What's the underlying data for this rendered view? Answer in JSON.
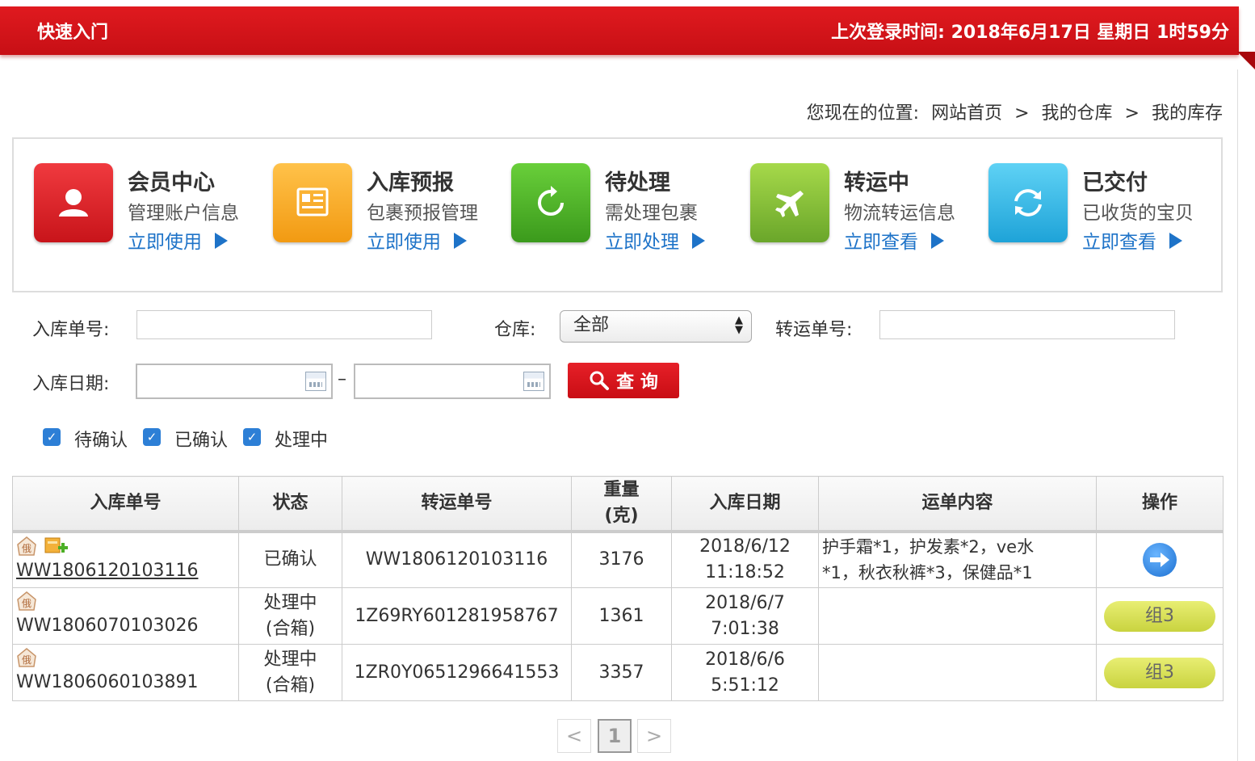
{
  "header": {
    "title": "快速入门",
    "last_login": "上次登录时间: 2018年6月17日 星期日 1时59分"
  },
  "breadcrumb": {
    "prefix": "您现在的位置:",
    "items": [
      "网站首页",
      "我的仓库",
      "我的库存"
    ],
    "separator": ">"
  },
  "quick_entries": [
    {
      "title": "会员中心",
      "desc": "管理账户信息",
      "action": "立即使用",
      "icon": "user-icon",
      "color": "#d9232a"
    },
    {
      "title": "入库预报",
      "desc": "包裹预报管理",
      "action": "立即使用",
      "icon": "document-icon",
      "color": "#f5a623"
    },
    {
      "title": "待处理",
      "desc": "需处理包裹",
      "action": "立即处理",
      "icon": "refresh-icon",
      "color": "#4caf26"
    },
    {
      "title": "转运中",
      "desc": "物流转运信息",
      "action": "立即查看",
      "icon": "airplane-icon",
      "color": "#8cc43a"
    },
    {
      "title": "已交付",
      "desc": "已收货的宝贝",
      "action": "立即查看",
      "icon": "sync-icon",
      "color": "#2cb5e8"
    }
  ],
  "search": {
    "inbound_no_label": "入库单号:",
    "inbound_no_value": "",
    "warehouse_label": "仓库:",
    "warehouse_selected": "全部",
    "transfer_no_label": "转运单号:",
    "transfer_no_value": "",
    "date_label": "入库日期:",
    "date_from": "",
    "date_to": "",
    "date_sep": "–",
    "query_button": "查 询"
  },
  "filters": [
    {
      "label": "待确认",
      "checked": true
    },
    {
      "label": "已确认",
      "checked": true
    },
    {
      "label": "处理中",
      "checked": true
    }
  ],
  "table": {
    "headers": [
      "入库单号",
      "状态",
      "转运单号",
      "重量\n(克)",
      "入库日期",
      "运单内容",
      "操作"
    ],
    "rows": [
      {
        "icons": [
          "ru-badge-icon",
          "add-package-icon"
        ],
        "id": "WW1806120103116",
        "status": "已确认",
        "transfer_no": "WW1806120103116",
        "weight": "3176",
        "date": "2018/6/12",
        "time": "11:18:52",
        "content_line1": "护手霜*1，护发素*2，ve水",
        "content_line2": "*1，秋衣秋裤*3，保健品*1",
        "action_type": "arrow",
        "action_label": ""
      },
      {
        "icons": [
          "ru-badge-icon"
        ],
        "id": "WW1806070103026",
        "status": "处理中",
        "status_sub": "(合箱)",
        "transfer_no": "1Z69RY601281958767",
        "weight": "1361",
        "date": "2018/6/7",
        "time": "7:01:38",
        "content_line1": "",
        "content_line2": "",
        "action_type": "group",
        "action_label": "组3"
      },
      {
        "icons": [
          "ru-badge-icon"
        ],
        "id": "WW1806060103891",
        "status": "处理中",
        "status_sub": "(合箱)",
        "transfer_no": "1ZR0Y0651296641553",
        "weight": "3357",
        "date": "2018/6/6",
        "time": "5:51:12",
        "content_line1": "",
        "content_line2": "",
        "action_type": "group",
        "action_label": "组3"
      }
    ]
  },
  "pagination": {
    "prev": "<",
    "current": "1",
    "next": ">"
  }
}
